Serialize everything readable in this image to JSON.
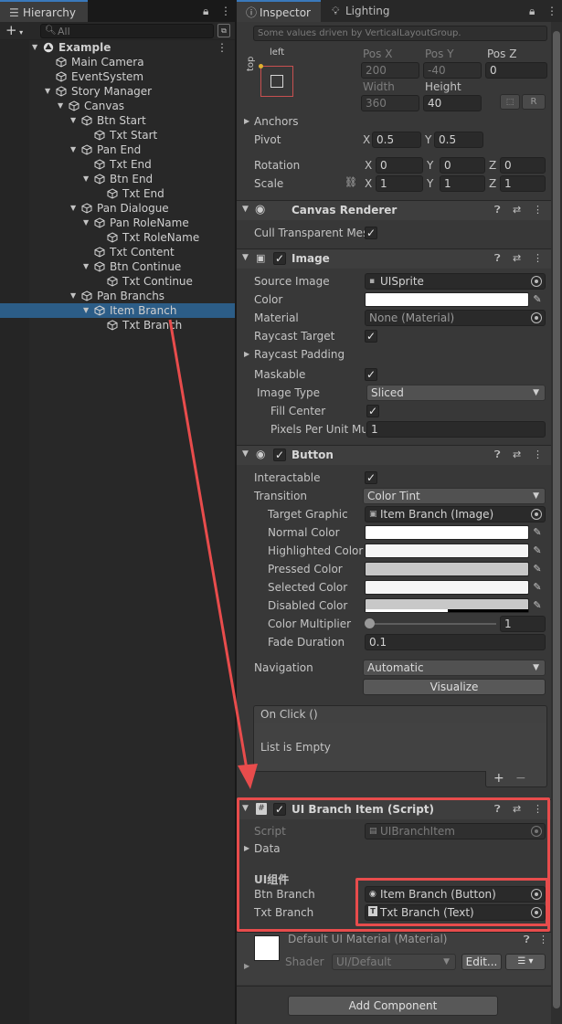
{
  "hierarchy": {
    "tab_label": "Hierarchy",
    "search_placeholder": "All",
    "scene": "Example",
    "items": [
      {
        "label": "Main Camera"
      },
      {
        "label": "EventSystem"
      },
      {
        "label": "Story Manager"
      },
      {
        "label": "Canvas"
      },
      {
        "label": "Btn Start"
      },
      {
        "label": "Txt Start"
      },
      {
        "label": "Pan End"
      },
      {
        "label": "Txt End"
      },
      {
        "label": "Btn End"
      },
      {
        "label": "Txt End"
      },
      {
        "label": "Pan Dialogue"
      },
      {
        "label": "Pan RoleName"
      },
      {
        "label": "Txt RoleName"
      },
      {
        "label": "Txt Content"
      },
      {
        "label": "Btn Continue"
      },
      {
        "label": "Txt Continue"
      },
      {
        "label": "Pan Branchs"
      },
      {
        "label": "Item Branch"
      },
      {
        "label": "Txt Branch"
      }
    ]
  },
  "inspector": {
    "tabs": [
      {
        "label": "Inspector"
      },
      {
        "label": "Lighting"
      }
    ],
    "driven_note": "Some values driven by VerticalLayoutGroup.",
    "rect": {
      "anchor_h": "left",
      "anchor_v": "top",
      "posx_label": "Pos X",
      "posy_label": "Pos Y",
      "posz_label": "Pos Z",
      "posx": "200",
      "posy": "-40",
      "posz": "0",
      "width_label": "Width",
      "height_label": "Height",
      "width": "360",
      "height": "40",
      "raw_btn": "R",
      "anchors": "Anchors",
      "pivot": "Pivot",
      "pivot_x": "0.5",
      "pivot_y": "0.5",
      "rotation": "Rotation",
      "rot_x": "0",
      "rot_y": "0",
      "rot_z": "0",
      "scale": "Scale",
      "scale_x": "1",
      "scale_y": "1",
      "scale_z": "1",
      "x": "X",
      "y": "Y",
      "z": "Z"
    },
    "canvas_renderer": {
      "title": "Canvas Renderer",
      "cull_label": "Cull Transparent Mes"
    },
    "image": {
      "title": "Image",
      "source_label": "Source Image",
      "source_value": "UISprite",
      "color_label": "Color",
      "material_label": "Material",
      "material_value": "None (Material)",
      "raycast_label": "Raycast Target",
      "raycast_padding": "Raycast Padding",
      "maskable": "Maskable",
      "type_label": "Image Type",
      "type_value": "Sliced",
      "fill_center": "Fill Center",
      "ppu_label": "Pixels Per Unit Mul",
      "ppu_value": "1"
    },
    "button": {
      "title": "Button",
      "interactable": "Interactable",
      "transition_label": "Transition",
      "transition_value": "Color Tint",
      "target_label": "Target Graphic",
      "target_value": "Item Branch (Image)",
      "normal": "Normal Color",
      "highlighted": "Highlighted Color",
      "pressed": "Pressed Color",
      "selected": "Selected Color",
      "disabled": "Disabled Color",
      "multiplier_label": "Color Multiplier",
      "multiplier_value": "1",
      "multiplier_fraction": 0.0,
      "fade_label": "Fade Duration",
      "fade_value": "0.1",
      "navigation_label": "Navigation",
      "navigation_value": "Automatic",
      "visualize": "Visualize",
      "onclick_title": "On Click ()",
      "onclick_empty": "List is Empty",
      "add": "+",
      "remove": "−"
    },
    "script": {
      "title": "UI Branch Item (Script)",
      "script_label": "Script",
      "script_value": "UIBranchItem",
      "data_label": "Data",
      "group_header": "UI组件",
      "btn_label": "Btn Branch",
      "btn_value": "Item Branch (Button)",
      "txt_label": "Txt Branch",
      "txt_value": "Txt Branch (Text)"
    },
    "material": {
      "title": "Default UI Material (Material)",
      "shader_label": "Shader",
      "shader_value": "UI/Default",
      "edit": "Edit..."
    },
    "add_component": "Add Component"
  },
  "colors": {
    "selection": "#2c5d87",
    "highlight": "#e84c4c",
    "tab_accent": "#3a79bb"
  }
}
